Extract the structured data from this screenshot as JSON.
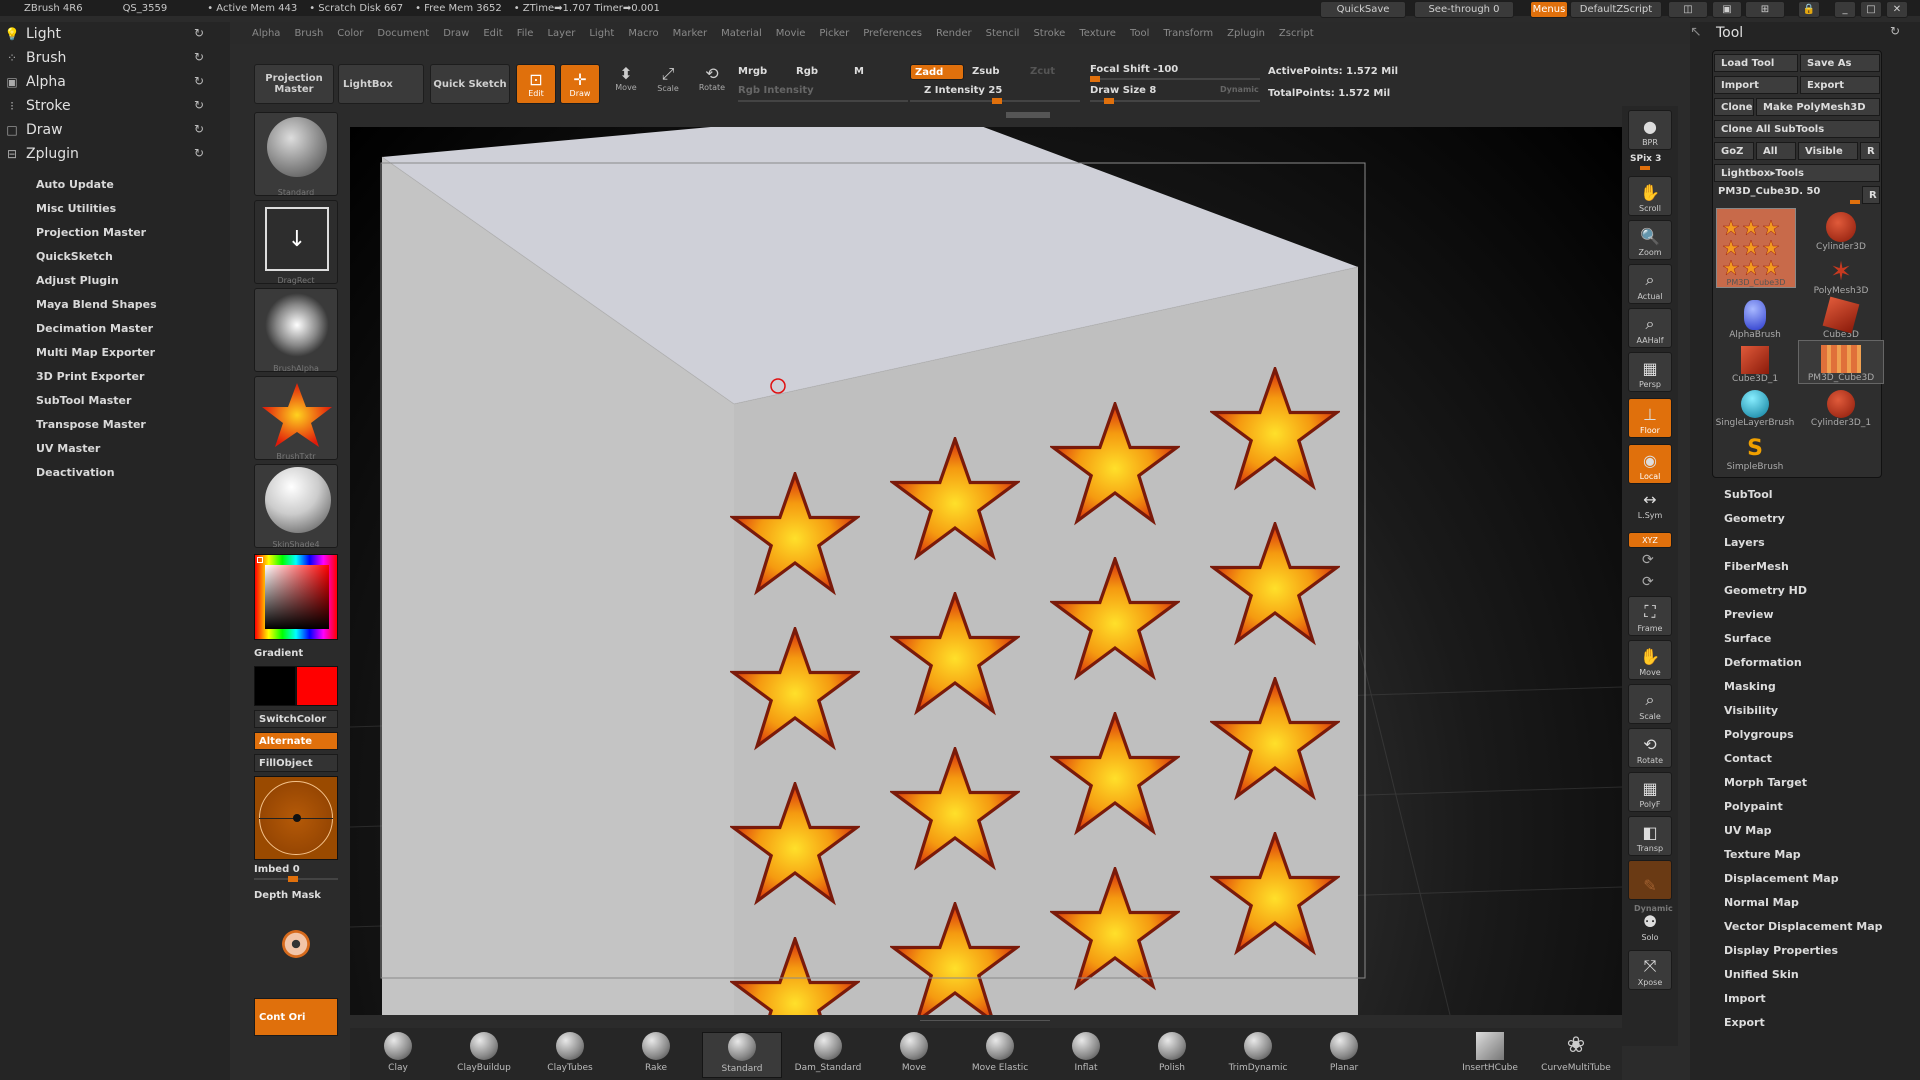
{
  "titlebar": {
    "app": "ZBrush 4R6",
    "qs": "QS_3559",
    "active_mem": "• Active Mem 443",
    "scratch": "• Scratch Disk 667",
    "free_mem": "• Free Mem 3652",
    "ztime": "• ZTime➡1.707 Timer➡0.001",
    "quicksave": "QuickSave",
    "seethrough": "See-through  0",
    "menus": "Menus",
    "script": "DefaultZScript"
  },
  "menubar": [
    "Alpha",
    "Brush",
    "Color",
    "Document",
    "Draw",
    "Edit",
    "File",
    "Layer",
    "Light",
    "Macro",
    "Marker",
    "Material",
    "Movie",
    "Picker",
    "Preferences",
    "Render",
    "Stencil",
    "Stroke",
    "Texture",
    "Tool",
    "Transform",
    "Zplugin",
    "Zscript"
  ],
  "leftmenu": {
    "top": [
      "Light",
      "Brush",
      "Alpha",
      "Stroke",
      "Draw",
      "Zplugin"
    ],
    "items": [
      "Auto Update",
      "Misc Utilities",
      "Projection Master",
      "QuickSketch",
      "Adjust Plugin",
      "Maya Blend Shapes",
      "Decimation Master",
      "Multi Map Exporter",
      "3D Print Exporter",
      "SubTool Master",
      "Transpose Master",
      "UV Master",
      "Deactivation"
    ]
  },
  "toolbar": {
    "projection_master": "Projection Master",
    "lightbox": "LightBox",
    "quick_sketch": "Quick Sketch",
    "edit": "Edit",
    "draw": "Draw",
    "move": "Move",
    "scale": "Scale",
    "rotate": "Rotate",
    "mrgb": "Mrgb",
    "rgb": "Rgb",
    "m": "M",
    "rgb_intensity": "Rgb Intensity",
    "zadd": "Zadd",
    "zsub": "Zsub",
    "zcut": "Zcut",
    "z_intensity": "Z Intensity 25",
    "focal_shift": "Focal Shift -100",
    "draw_size": "Draw Size 8",
    "dynamic": "Dynamic",
    "active_points": "ActivePoints: 1.572  Mil",
    "total_points": "TotalPoints: 1.572  Mil"
  },
  "shelf": {
    "standard": "Standard",
    "dragrect": "DragRect",
    "brushalpha": "BrushAlpha",
    "brushtxtr": "BrushTxtr",
    "skinshade": "SkinShade4",
    "gradient": "Gradient",
    "switchcolor": "SwitchColor",
    "alternate": "Alternate",
    "fillobject": "FillObject",
    "imbed": "Imbed 0",
    "depth_mask": "Depth Mask",
    "cont_ori": "Cont Ori"
  },
  "colors": {
    "accent": "#e0700c",
    "primary": "#000000",
    "secondary": "#ff0000"
  },
  "rightnav": [
    "BPR",
    "SPix 3",
    "Scroll",
    "Zoom",
    "Actual",
    "AAHalf",
    "Persp",
    "Floor",
    "Local",
    "L.Sym",
    "XYZ",
    "Frame",
    "Move",
    "Scale",
    "Rotate",
    "PolyF",
    "Transp",
    "Dynamic",
    "Solo",
    "Xpose"
  ],
  "toolpanel": {
    "title": "Tool",
    "load_tool": "Load Tool",
    "save_as": "Save As",
    "import": "Import",
    "export": "Export",
    "clone": "Clone",
    "make_polymesh": "Make PolyMesh3D",
    "clone_all": "Clone  All SubTools",
    "goz": "GoZ",
    "all": "All",
    "visible": "Visible",
    "r": "R",
    "lightbox_tools": "Lightbox▸Tools",
    "current_tool": "PM3D_Cube3D. 50",
    "tools": [
      "PM3D_Cube3D",
      "Cylinder3D",
      "PolyMesh3D",
      "AlphaBrush",
      "Cube3D",
      "Cube3D_1",
      "PM3D_Cube3D",
      "SingleLayerBrush",
      "Cylinder3D_1",
      "SimpleBrush"
    ],
    "sections": [
      "SubTool",
      "Geometry",
      "Layers",
      "FiberMesh",
      "Geometry HD",
      "Preview",
      "Surface",
      "Deformation",
      "Masking",
      "Visibility",
      "Polygroups",
      "Contact",
      "Morph Target",
      "Polypaint",
      "UV Map",
      "Texture Map",
      "Displacement Map",
      "Normal Map",
      "Vector Displacement Map",
      "Display Properties",
      "Unified Skin",
      "Import",
      "Export"
    ]
  },
  "brushbar": [
    "Clay",
    "ClayBuildup",
    "ClayTubes",
    "Rake",
    "Standard",
    "Dam_Standard",
    "Move",
    "Move Elastic",
    "Inflat",
    "Polish",
    "TrimDynamic",
    "Planar",
    "InsertHCube",
    "CurveMultiTube"
  ]
}
